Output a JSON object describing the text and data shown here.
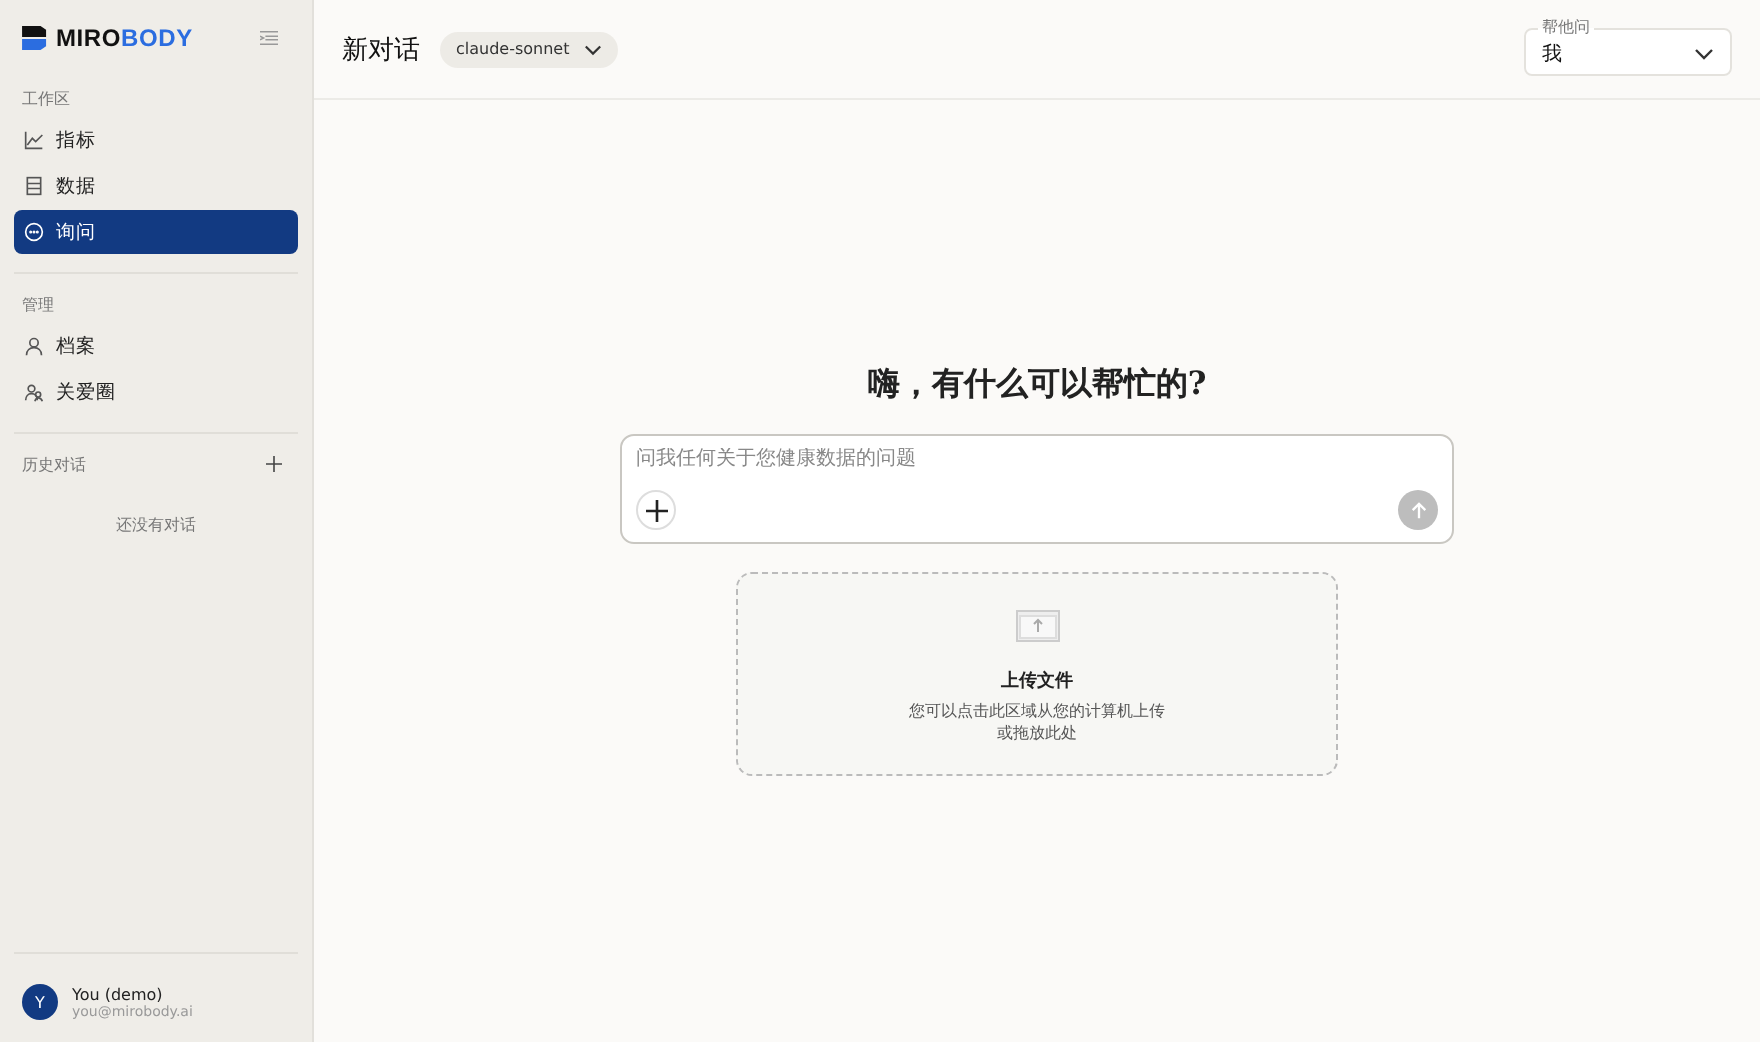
{
  "sidebar": {
    "brand": {
      "primary": "MIRO",
      "accent": "BODY"
    },
    "sections": [
      {
        "heading": "工作区",
        "items": [
          {
            "label": "指标",
            "selected": false
          },
          {
            "label": "数据",
            "selected": false
          },
          {
            "label": "询问",
            "selected": true
          }
        ]
      },
      {
        "heading": "管理",
        "items": [
          {
            "label": "档案",
            "selected": false
          },
          {
            "label": "关爱圈",
            "selected": false
          }
        ]
      }
    ],
    "history": {
      "heading": "历史对话",
      "empty_text": "还没有对话"
    },
    "user": {
      "initial": "Y",
      "name": "You (demo)",
      "email": "you@mirobody.ai"
    }
  },
  "header": {
    "title": "新对话",
    "model": "claude-sonnet",
    "ask_for": {
      "label": "帮他问",
      "value": "我"
    }
  },
  "main": {
    "greeting": "嗨，有什么可以帮忙的?",
    "input": {
      "placeholder": "问我任何关于您健康数据的问题"
    },
    "upload": {
      "title": "上传文件",
      "lines": [
        "您可以点击此区域从您的计算机上传",
        "或拖放此处"
      ]
    }
  }
}
